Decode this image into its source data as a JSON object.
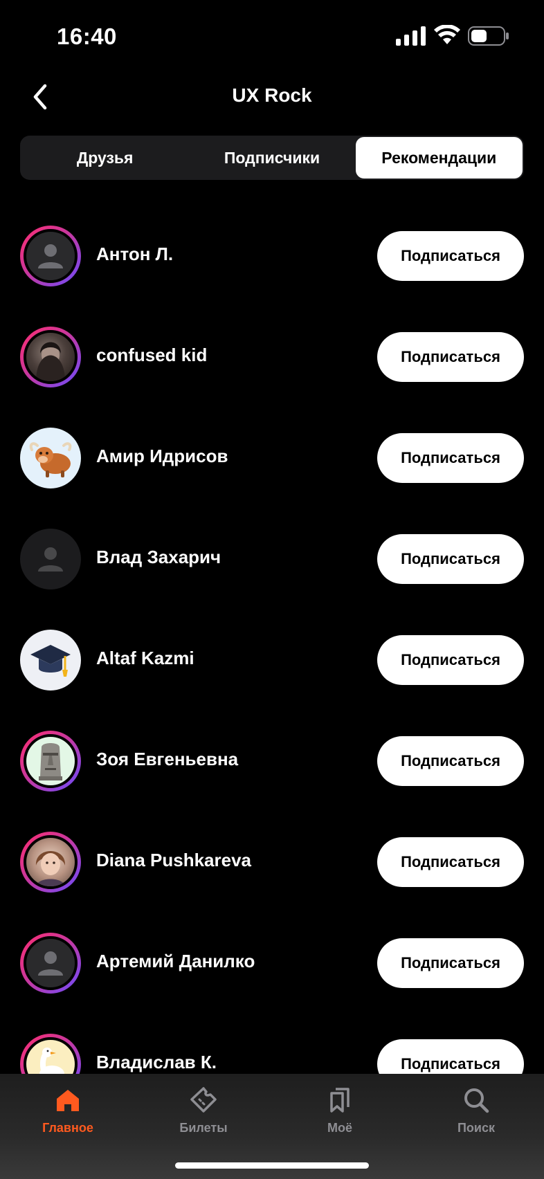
{
  "status_bar": {
    "time": "16:40"
  },
  "header": {
    "title": "UX Rock"
  },
  "segments": [
    {
      "label": "Друзья",
      "active": false
    },
    {
      "label": "Подписчики",
      "active": false
    },
    {
      "label": "Рекомендации",
      "active": true
    }
  ],
  "users": [
    {
      "name": "Антон Л.",
      "avatar": "placeholder-person",
      "ring": true,
      "button": "Подписаться"
    },
    {
      "name": "confused kid",
      "avatar": "photo",
      "ring": true,
      "button": "Подписаться"
    },
    {
      "name": "Амир Идрисов",
      "avatar": "yak-emoji",
      "ring": false,
      "button": "Подписаться"
    },
    {
      "name": "Влад Захарич",
      "avatar": "placeholder-person",
      "ring": false,
      "button": "Подписаться"
    },
    {
      "name": "Altaf Kazmi",
      "avatar": "graduation-cap-emoji",
      "ring": false,
      "button": "Подписаться"
    },
    {
      "name": "Зоя Евгеньевна",
      "avatar": "moai-emoji",
      "ring": true,
      "button": "Подписаться"
    },
    {
      "name": "Diana Pushkareva",
      "avatar": "photo",
      "ring": true,
      "button": "Подписаться"
    },
    {
      "name": "Артемий Данилко",
      "avatar": "placeholder-person",
      "ring": true,
      "button": "Подписаться"
    },
    {
      "name": "Владислав К.",
      "avatar": "goose-emoji",
      "ring": true,
      "button": "Подписаться"
    }
  ],
  "tabbar": [
    {
      "label": "Главное",
      "icon": "home-icon",
      "active": true
    },
    {
      "label": "Билеты",
      "icon": "ticket-icon",
      "active": false
    },
    {
      "label": "Моё",
      "icon": "bookmarks-icon",
      "active": false
    },
    {
      "label": "Поиск",
      "icon": "search-icon",
      "active": false
    }
  ],
  "colors": {
    "accent": "#ff5a1f",
    "background": "#000000",
    "ring_start": "#ff2d6f",
    "ring_end": "#6a4cff"
  }
}
